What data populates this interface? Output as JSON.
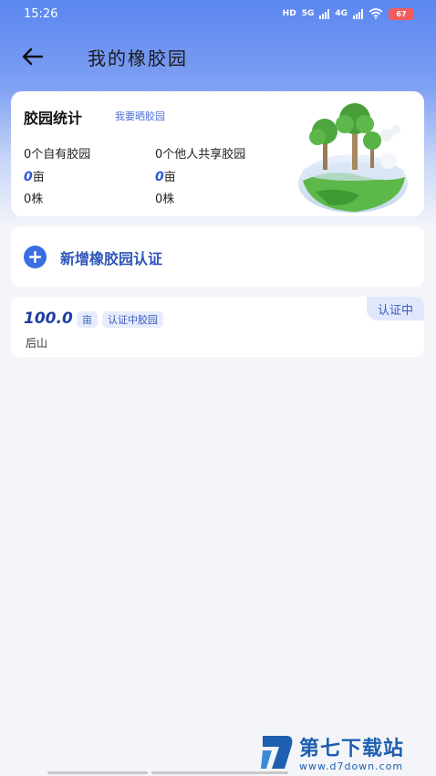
{
  "status_bar": {
    "time": "15:26",
    "network_labels": [
      "HD",
      "5G",
      "4G"
    ],
    "battery": "67"
  },
  "header": {
    "title": "我的橡胶园"
  },
  "stats": {
    "title": "胶园统计",
    "link": "我要晒胶园",
    "own_count": "0个自有胶园",
    "shared_count": "0个他人共享胶园",
    "own_area_value": "0",
    "own_area_unit": "亩",
    "shared_area_value": "0",
    "shared_area_unit": "亩",
    "own_trees": "0株",
    "shared_trees": "0株"
  },
  "add_card": {
    "label": "新增橡胶园认证"
  },
  "gardens": [
    {
      "area": "100.0",
      "unit_tag": "亩",
      "type_tag": "认证中胶园",
      "name": "后山",
      "status": "认证中"
    }
  ],
  "watermark": {
    "title": "第七下载站",
    "url": "www.d7down.com"
  },
  "colors": {
    "primary": "#3a6de0",
    "header_gradient_top": "#5a86f0",
    "accent_text": "#2e56b8",
    "battery_red": "#f05c5c"
  },
  "icons": {
    "back": "arrow-left-icon",
    "add": "plus-circle-icon",
    "illustration": "trees-globe-illustration"
  }
}
